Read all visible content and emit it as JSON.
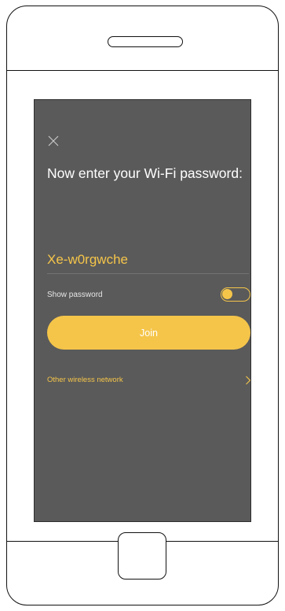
{
  "screen": {
    "title": "Now enter your Wi-Fi password:",
    "password_value": "Xe-w0rgwche",
    "show_password_label": "Show password",
    "show_password_on": true,
    "join_label": "Join",
    "other_network_label": "Other wireless network"
  },
  "icons": {
    "close": "close-icon",
    "chevron": "chevron-right-icon"
  },
  "colors": {
    "screen_bg": "#5a5a5a",
    "accent": "#f5c54a",
    "text": "#ffffff"
  }
}
